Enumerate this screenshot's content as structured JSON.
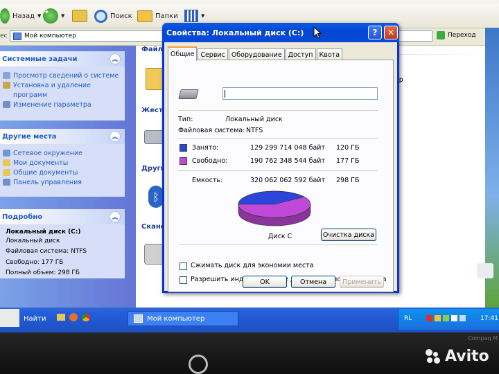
{
  "toolbar": {
    "back_label": "Назад",
    "search_label": "Поиск",
    "folders_label": "Папки"
  },
  "address": {
    "label": "ес",
    "value": "Мой компьютер",
    "go_label": "Переход"
  },
  "taskpane": {
    "system_tasks": {
      "title": "Системные задачи",
      "items": [
        "Просмотр сведений о системе",
        "Установка и удаление",
        "программ",
        "Изменение параметра"
      ]
    },
    "other_places": {
      "title": "Другие места",
      "items": [
        "Сетевое окружение",
        "Мои документы",
        "Общие документы",
        "Панель управления"
      ]
    },
    "details": {
      "title": "Подробно",
      "name": "Локальный диск (C:)",
      "type": "Локальный диск",
      "fs": "Файловая система: NTFS",
      "free": "Свободно: 177 ГБ",
      "total": "Полный объем: 298 ГБ"
    }
  },
  "content": {
    "section1": "Файль",
    "section2": "Жест",
    "section3": "Други",
    "section4": "Скане",
    "side_text": "ор"
  },
  "dialog": {
    "title": "Свойства: Локальный диск (C:)",
    "help_glyph": "?",
    "close_glyph": "✕",
    "tabs": [
      "Общие",
      "Сервис",
      "Оборудование",
      "Доступ",
      "Квота"
    ],
    "active_tab": "Общие",
    "name_value": "",
    "type_label": "Тип:",
    "type_value": "Локальный диск",
    "fs_label": "Файловая система:",
    "fs_value": "NTFS",
    "used": {
      "label": "Занято:",
      "bytes": "129 299 714 048 байт",
      "size": "120 ГБ",
      "color": "#2b45d8"
    },
    "free": {
      "label": "Свободно:",
      "bytes": "190 762 348 544 байт",
      "size": "177 ГБ",
      "color": "#c04ad7"
    },
    "capacity": {
      "label": "Емкость:",
      "bytes": "320 062 062 592 байт",
      "size": "298 ГБ"
    },
    "used_fraction": 0.404,
    "disk_label": "Диск C",
    "cleanup_label": "Очистка диска",
    "compress_label": "Сжимать диск для экономии места",
    "index_label": "Разрешить индексирование диска для быстрого поиска",
    "ok_label": "OK",
    "cancel_label": "Отмена",
    "apply_label": "Применить"
  },
  "taskbar": {
    "search_label": "Найти",
    "window_task": "Мой компьютер",
    "lang": "RL",
    "time": "17:41"
  },
  "bezel": {
    "brand_text": "Compaq M",
    "watermark": "Avito"
  }
}
